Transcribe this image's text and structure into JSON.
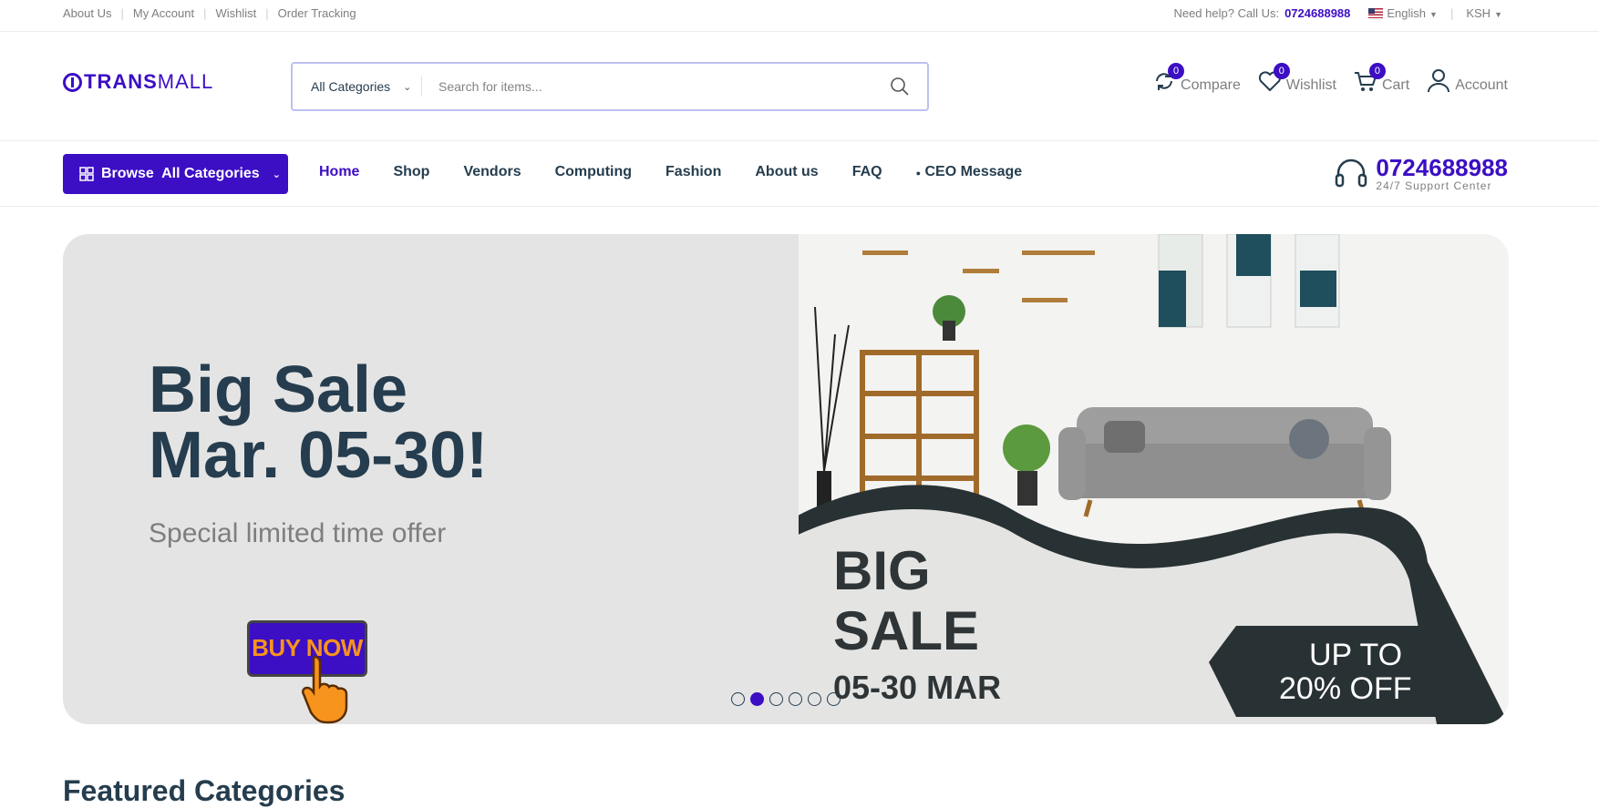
{
  "topbar": {
    "links": [
      "About Us",
      "My Account",
      "Wishlist",
      "Order Tracking"
    ],
    "help_label": "Need help? Call Us:",
    "help_phone": "0724688988",
    "language": "English",
    "currency": "KSH"
  },
  "header": {
    "logo_bold": "TRANS",
    "logo_light": "MALL",
    "search": {
      "category": "All Categories",
      "placeholder": "Search for items..."
    },
    "actions": [
      {
        "label": "Compare",
        "count": "0",
        "icon": "compare-icon"
      },
      {
        "label": "Wishlist",
        "count": "0",
        "icon": "heart-icon"
      },
      {
        "label": "Cart",
        "count": "0",
        "icon": "cart-icon"
      },
      {
        "label": "Account",
        "icon": "user-icon"
      }
    ]
  },
  "nav": {
    "browse_label": "Browse  All Categories",
    "items": [
      "Home",
      "Shop",
      "Vendors",
      "Computing",
      "Fashion",
      "About us",
      "FAQ",
      "CEO Message"
    ],
    "active": "Home",
    "support_phone": "0724688988",
    "support_sub": "24/7 Support Center"
  },
  "hero": {
    "title_line1": "Big Sale",
    "title_line2": "Mar. 05-30!",
    "subtitle": "Special limited time offer",
    "button_label": "BUY NOW",
    "banner_big": "BIG",
    "banner_sale": "SALE",
    "banner_dates": "05-30 MAR",
    "banner_tag_line1": "UP TO",
    "banner_tag_line2": "20% OFF",
    "slide_count": 6,
    "active_slide": 2
  },
  "featured": {
    "title": "Featured Categories"
  },
  "colors": {
    "brand": "#3c0ec4",
    "heading": "#253d4e",
    "muted": "#7e7e7e",
    "button_text": "#f7941d"
  }
}
